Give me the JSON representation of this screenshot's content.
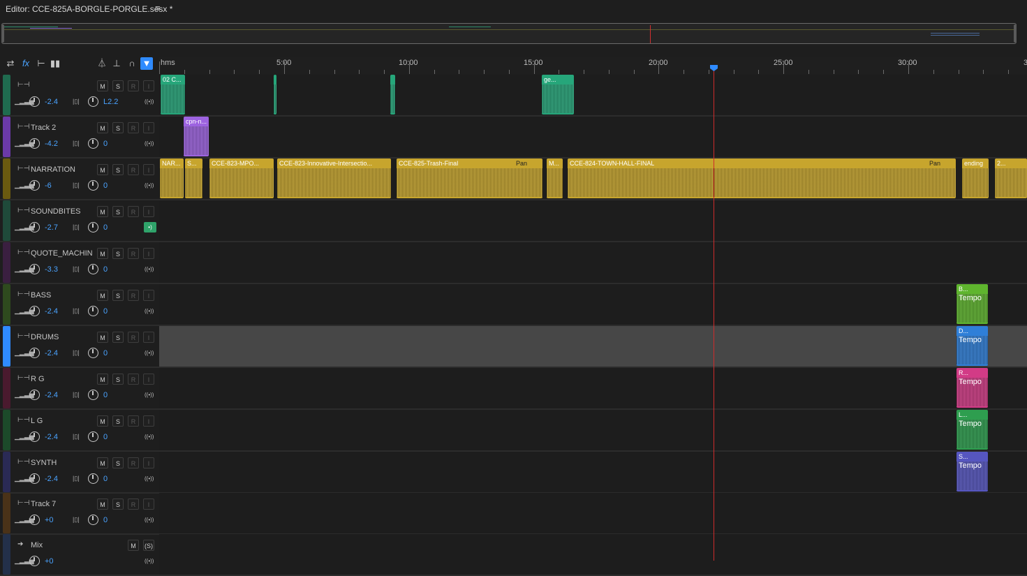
{
  "editor": {
    "title": "Editor: CCE-825A-BORGLE-PORGLE.sesx *",
    "menu_icon": "≡"
  },
  "toolbar": {
    "icons": [
      "⇄",
      "fx",
      "⊢",
      "▮▮",
      "⏃",
      "⊥",
      "∩",
      "▼"
    ]
  },
  "ruler": {
    "unit": "hms",
    "labels": [
      {
        "t": "5:00"
      },
      {
        "t": "10:00"
      },
      {
        "t": "15:00"
      },
      {
        "t": "20:00"
      },
      {
        "t": "25:00"
      },
      {
        "t": "30:00"
      },
      {
        "t": "3"
      }
    ]
  },
  "tracks": [
    {
      "name": "",
      "vol": "-2.4",
      "pan": "L2.2",
      "color": "#1f6b4f",
      "lane": "#1d1d1d",
      "clips": [
        {
          "name": "02 C...",
          "color": "#26a67a"
        },
        {
          "name": "",
          "color": "#26a67a"
        },
        {
          "name": "",
          "color": "#26a67a"
        },
        {
          "name": "ge...",
          "color": "#26a67a"
        }
      ]
    },
    {
      "name": "Track 2",
      "vol": "-4.2",
      "pan": "0",
      "color": "#6b3aa8",
      "lane": "#1d1d1d",
      "clips": [
        {
          "name": "cpn-n...",
          "color": "#9d63e0"
        }
      ]
    },
    {
      "name": "NARRATION",
      "vol": "-6",
      "pan": "0",
      "color": "#6a5a10",
      "lane": "#1d1d1d",
      "clips": [
        {
          "name": "NAR...",
          "color": "#c7a52d"
        },
        {
          "name": "S...",
          "color": "#c7a52d"
        },
        {
          "name": "CCE-823-MPO...",
          "color": "#c7a52d"
        },
        {
          "name": "CCE-823-Innovative-Intersectio...",
          "color": "#c7a52d"
        },
        {
          "name": "CCE-825-Trash-Final",
          "color": "#c7a52d"
        },
        {
          "name": "M...",
          "color": "#c7a52d"
        },
        {
          "name": "CCE-824-TOWN-HALL-FINAL",
          "color": "#c7a52d"
        },
        {
          "name": "ending",
          "color": "#c7a52d"
        },
        {
          "name": "2...",
          "color": "#c7a52d"
        }
      ],
      "pan_label": "Pan"
    },
    {
      "name": "SOUNDBITES",
      "vol": "-2.7",
      "pan": "0",
      "color": "#1f4a3a",
      "lane": "#1d1d1d",
      "clips": []
    },
    {
      "name": "QUOTE_MACHIN",
      "vol": "-3.3",
      "pan": "0",
      "color": "#3a1f40",
      "lane": "#1d1d1d",
      "clips": []
    },
    {
      "name": "BASS",
      "vol": "-2.4",
      "pan": "0",
      "color": "#2e4a1e",
      "lane": "#1d1d1d",
      "clips": [
        {
          "name": "B...",
          "color": "#5fb52e"
        }
      ],
      "tempo": "Tempo"
    },
    {
      "name": "DRUMS",
      "vol": "-2.4",
      "pan": "0",
      "color": "#2f8bff",
      "lane": "#474747",
      "clips": [
        {
          "name": "D...",
          "color": "#2f7fd8"
        }
      ],
      "tempo": "Tempo"
    },
    {
      "name": "R G",
      "vol": "-2.4",
      "pan": "0",
      "color": "#4a1a2e",
      "lane": "#1d1d1d",
      "clips": [
        {
          "name": "R...",
          "color": "#d23b86"
        }
      ],
      "tempo": "Tempo"
    },
    {
      "name": "L G",
      "vol": "-2.4",
      "pan": "0",
      "color": "#1c4a2a",
      "lane": "#1d1d1d",
      "clips": [
        {
          "name": "L...",
          "color": "#2e9e4f"
        }
      ],
      "tempo": "Tempo"
    },
    {
      "name": "SYNTH",
      "vol": "-2.4",
      "pan": "0",
      "color": "#2a2a55",
      "lane": "#1d1d1d",
      "clips": [
        {
          "name": "S...",
          "color": "#5656c0"
        }
      ],
      "tempo": "Tempo"
    },
    {
      "name": "Track 7",
      "vol": "+0",
      "pan": "0",
      "color": "#4a3218",
      "lane": "#1d1d1d",
      "clips": []
    },
    {
      "name": "Mix",
      "vol": "+0",
      "pan": "",
      "color": "#23304a",
      "lane": "#1d1d1d",
      "clips": []
    }
  ],
  "buttons": {
    "m": "M",
    "s": "S",
    "r": "R",
    "i": "I",
    "s_circ": "(S)"
  },
  "icons": {
    "vol": "volume-icon",
    "pan": "pan-icon",
    "output": "output-icon",
    "dropdown": "⌄"
  }
}
